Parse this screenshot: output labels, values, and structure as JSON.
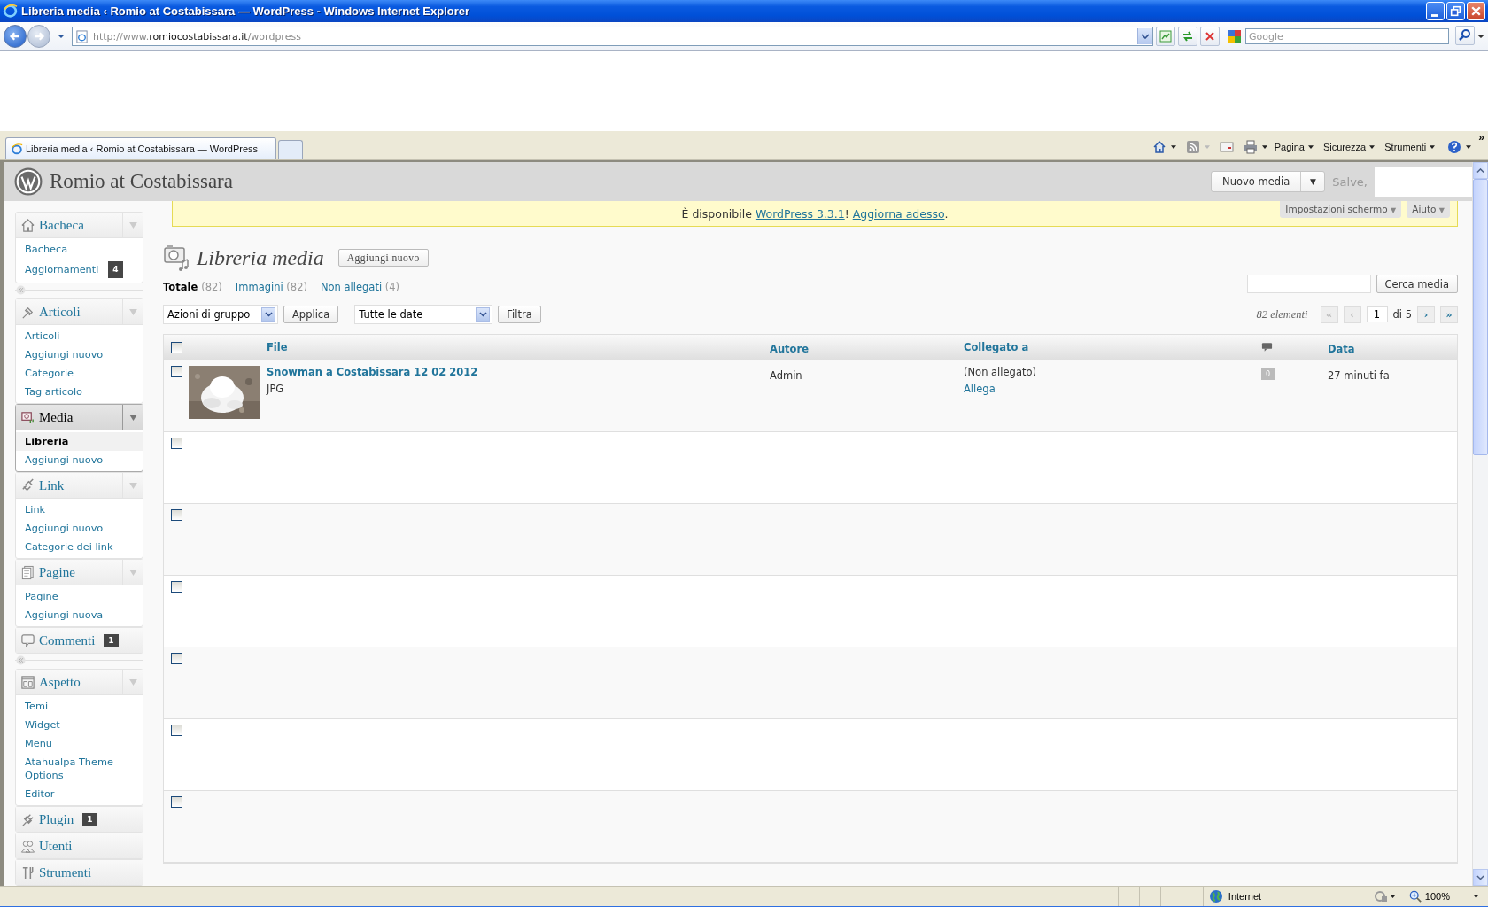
{
  "window": {
    "title": "Libreria media ‹ Romio at Costabissara — WordPress - Windows Internet Explorer"
  },
  "address_bar": {
    "url_prefix": "http://www.",
    "url_domain": "romiocostabissara.it",
    "url_path": "/wordpress"
  },
  "search": {
    "placeholder": "Google"
  },
  "tabs": [
    {
      "label": "Libreria media ‹ Romio at Costabissara — WordPress",
      "selected": true
    }
  ],
  "command_bar": {
    "menus": [
      "Pagina",
      "Sicurezza",
      "Strumenti"
    ],
    "overflow": "»"
  },
  "site": {
    "title": "Romio at Costabissara",
    "new_button": "Nuovo media",
    "new_caret": "▼",
    "greeting": "Salve,"
  },
  "notice": {
    "before": "È disponibile ",
    "link1": "WordPress 3.3.1",
    "between": "! ",
    "link2": "Aggiorna adesso",
    "after": "."
  },
  "screen_tabs": [
    {
      "label": "Impostazioni schermo",
      "caret": "▼"
    },
    {
      "label": "Aiuto",
      "caret": "▼"
    }
  ],
  "menu": [
    {
      "kind": "section",
      "label": "Bacheca",
      "expanded": true,
      "selected": false,
      "children": [
        {
          "label": "Bacheca",
          "selected": false
        },
        {
          "label": "Aggiornamenti",
          "badge": "4",
          "selected": false
        }
      ]
    },
    {
      "kind": "separator"
    },
    {
      "kind": "section",
      "label": "Articoli",
      "expanded": true,
      "selected": false,
      "children": [
        {
          "label": "Articoli",
          "selected": false
        },
        {
          "label": "Aggiungi nuovo",
          "selected": false
        },
        {
          "label": "Categorie",
          "selected": false
        },
        {
          "label": "Tag articolo",
          "selected": false
        }
      ]
    },
    {
      "kind": "section",
      "label": "Media",
      "expanded": true,
      "selected": true,
      "children": [
        {
          "label": "Libreria",
          "selected": true
        },
        {
          "label": "Aggiungi nuovo",
          "selected": false
        }
      ]
    },
    {
      "kind": "section",
      "label": "Link",
      "expanded": true,
      "selected": false,
      "children": [
        {
          "label": "Link",
          "selected": false
        },
        {
          "label": "Aggiungi nuovo",
          "selected": false
        },
        {
          "label": "Categorie dei link",
          "selected": false
        }
      ]
    },
    {
      "kind": "section",
      "label": "Pagine",
      "expanded": true,
      "selected": false,
      "children": [
        {
          "label": "Pagine",
          "selected": false
        },
        {
          "label": "Aggiungi nuova",
          "selected": false
        }
      ]
    },
    {
      "kind": "section",
      "label": "Commenti",
      "badge": "1",
      "expanded": false,
      "selected": false
    },
    {
      "kind": "separator"
    },
    {
      "kind": "section",
      "label": "Aspetto",
      "expanded": true,
      "selected": false,
      "children": [
        {
          "label": "Temi",
          "selected": false
        },
        {
          "label": "Widget",
          "selected": false
        },
        {
          "label": "Menu",
          "selected": false
        },
        {
          "label": "Atahualpa Theme Options",
          "selected": false
        },
        {
          "label": "Editor",
          "selected": false
        }
      ]
    },
    {
      "kind": "section",
      "label": "Plugin",
      "badge": "1",
      "expanded": false,
      "selected": false
    },
    {
      "kind": "section",
      "label": "Utenti",
      "expanded": false,
      "selected": false
    },
    {
      "kind": "section",
      "label": "Strumenti",
      "expanded": false,
      "selected": false
    }
  ],
  "page": {
    "title": "Libreria media",
    "add_button": "Aggiungi nuovo"
  },
  "filters": [
    {
      "label": "Totale",
      "count": "(82)",
      "selected": true
    },
    {
      "label": "Immagini",
      "count": "(82)",
      "selected": false
    },
    {
      "label": "Non allegati",
      "count": "(4)",
      "selected": false
    }
  ],
  "search_button": "Cerca media",
  "bulk_select": "Azioni di gruppo",
  "apply_button": "Applica",
  "date_select": "Tutte le date",
  "filter_button": "Filtra",
  "pagination": {
    "count": "82 elementi",
    "first": "«",
    "prev": "‹",
    "page": "1",
    "of": "di 5",
    "next": "›",
    "last": "»"
  },
  "table": {
    "select_all_checked": false,
    "columns": [
      "File",
      "Autore",
      "Collegato a",
      "Data"
    ],
    "rows": [
      {
        "kind": "media",
        "checked": false,
        "title": "Snowman a Costabissara 12 02 2012",
        "type": "JPG",
        "author": "Admin",
        "attached": "(Non allegato)",
        "attach_link": "Allega",
        "comments": "0",
        "date": "27 minuti fa"
      },
      {
        "kind": "empty",
        "checked": false
      },
      {
        "kind": "empty",
        "checked": false
      },
      {
        "kind": "empty",
        "checked": false
      },
      {
        "kind": "empty",
        "checked": false
      },
      {
        "kind": "empty",
        "checked": false
      },
      {
        "kind": "empty",
        "checked": false
      }
    ]
  },
  "status_bar": {
    "zone": "Internet",
    "zoom": "100%"
  }
}
